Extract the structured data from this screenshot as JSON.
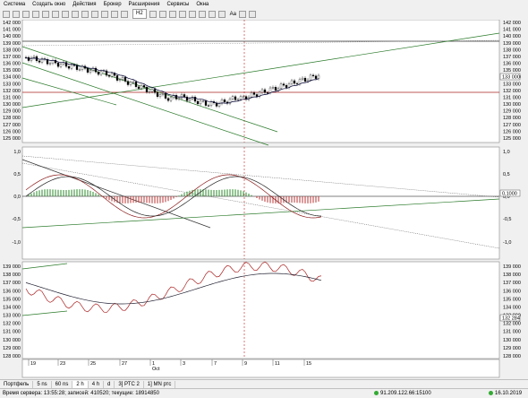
{
  "menu": [
    "Система",
    "Создать окно",
    "Действия",
    "Брокер",
    "Расширения",
    "Сервисы",
    "Окна"
  ],
  "toolbar": {
    "timeframe": "H2",
    "font_label": "Aa"
  },
  "price_axis": {
    "labels": [
      "142 000",
      "141 000",
      "140 000",
      "139 000",
      "138 000",
      "137 000",
      "136 000",
      "135 000",
      "134 000",
      "133 000",
      "132 000",
      "131 000",
      "130 000",
      "129 000",
      "128 000",
      "127 000",
      "126 000",
      "125 000"
    ],
    "current": "133 000"
  },
  "macd_axis": {
    "labels": [
      "1,0",
      "0,5",
      "0,0",
      "-0,5",
      "-1,0"
    ],
    "current": "0,1000"
  },
  "lower_axis": {
    "labels": [
      "139 000",
      "138 000",
      "137 000",
      "136 000",
      "135 000",
      "134 000",
      "133 000",
      "132 000",
      "131 000",
      "130 000",
      "129 000",
      "128 000"
    ],
    "current": "132 284"
  },
  "time_axis": {
    "labels": [
      "19",
      "23",
      "25",
      "27",
      "1",
      "3",
      "7",
      "9",
      "11",
      "15"
    ],
    "month": "Oct"
  },
  "tabs": [
    "Портфель",
    "5 ns",
    "60 ns",
    "2 h",
    "4 h",
    "d",
    "3] РТС 2",
    "1] MN ртс"
  ],
  "active_tab": 3,
  "status": {
    "left": "Время сервера: 13:55:28; записей: 410520; текущие: 18914850",
    "connection": "91.209.122.66:15100",
    "date": "16.10.2019"
  }
}
